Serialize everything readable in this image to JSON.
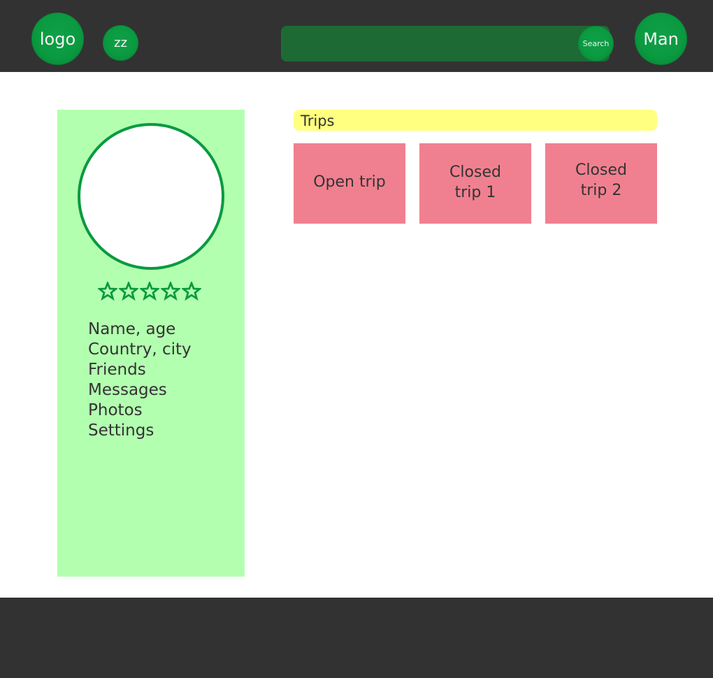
{
  "header": {
    "logo_label": "logo",
    "secondary_label": "zz",
    "search": {
      "placeholder": "",
      "value": "",
      "button_label": "Search"
    },
    "user_label": "Man"
  },
  "profile": {
    "rating": {
      "value": 0,
      "max": 5
    },
    "menu": [
      {
        "label": "Name, age"
      },
      {
        "label": "Country, city"
      },
      {
        "label": "Friends"
      },
      {
        "label": "Messages"
      },
      {
        "label": "Photos"
      },
      {
        "label": "Settings"
      }
    ]
  },
  "trips": {
    "title": "Trips",
    "cards": [
      {
        "label": "Open trip"
      },
      {
        "label": "Closed trip 1"
      },
      {
        "label": "Closed trip 2"
      }
    ]
  },
  "colors": {
    "header_bg": "#323232",
    "accent_green": "#0a9a40",
    "search_bg": "#1d6a35",
    "sidebar_bg": "#b3ffb0",
    "trips_title_bg": "#ffff80",
    "trip_card_bg": "#f08090"
  }
}
